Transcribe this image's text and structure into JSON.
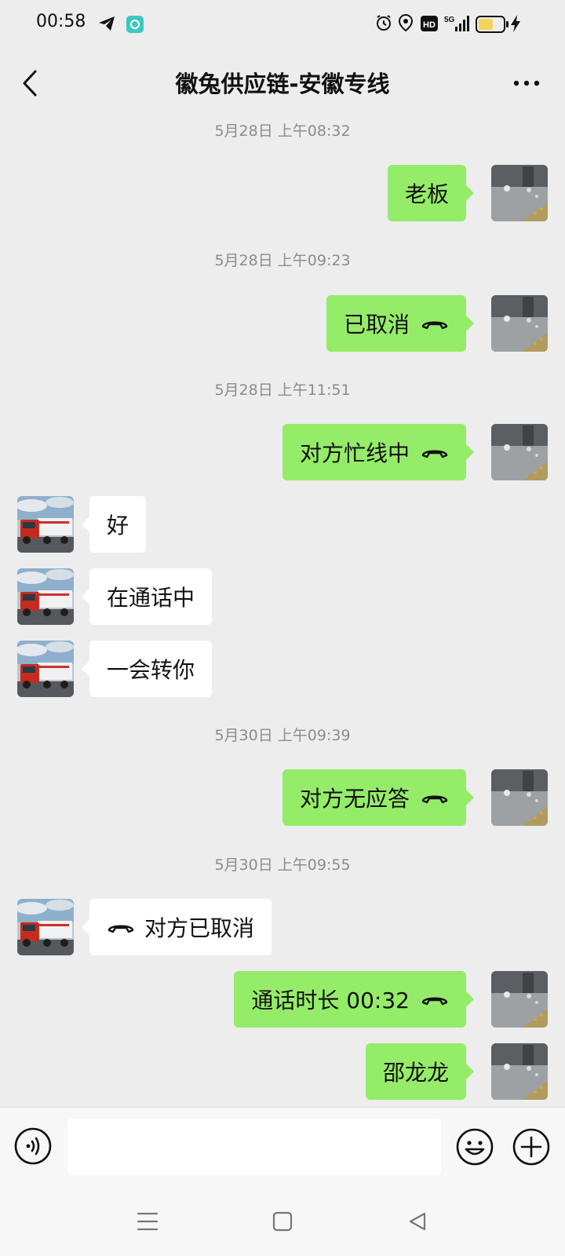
{
  "status_bar": {
    "time": "00:58",
    "left_icons": [
      "telegram-icon",
      "app-notification-icon"
    ],
    "right_icons": [
      "alarm-icon",
      "location-icon",
      "hd-icon",
      "5g-signal-icon",
      "battery-icon",
      "charging-icon"
    ],
    "hd_label": "HD",
    "network_label": "5G",
    "battery_level": 0.6
  },
  "header": {
    "title": "徽兔供应链-安徽专线",
    "back_icon": "chevron-left-icon",
    "more_icon": "more-dots-icon"
  },
  "colors": {
    "background": "#ededed",
    "sent_bubble": "#95ec69",
    "received_bubble": "#ffffff",
    "timestamp": "#8c8c8c"
  },
  "messages": {
    "ts1": "5月28日 上午08:32",
    "m1": "老板",
    "ts2": "5月28日 上午09:23",
    "m2": "已取消",
    "ts3": "5月28日 上午11:51",
    "m3": "对方忙线中",
    "m4": "好",
    "m5": "在通话中",
    "m6": "一会转你",
    "ts4": "5月30日 上午09:39",
    "m7": "对方无应答",
    "ts5": "5月30日 上午09:55",
    "m8": "对方已取消",
    "m9": "通话时长 00:32",
    "m10": "邵龙龙"
  },
  "input_bar": {
    "voice_icon": "voice-input-icon",
    "text_value": "",
    "emoji_icon": "emoji-icon",
    "plus_icon": "plus-circle-icon"
  },
  "nav_bar": {
    "icons": [
      "menu-icon",
      "home-square-icon",
      "back-triangle-icon"
    ]
  }
}
